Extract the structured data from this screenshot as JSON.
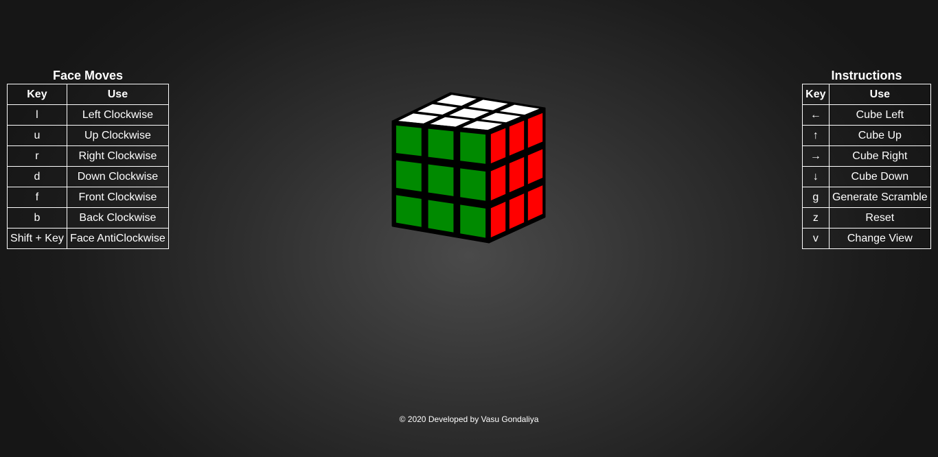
{
  "face_moves": {
    "title": "Face Moves",
    "header_key": "Key",
    "header_use": "Use",
    "rows": [
      {
        "key": "l",
        "use": "Left Clockwise"
      },
      {
        "key": "u",
        "use": "Up Clockwise"
      },
      {
        "key": "r",
        "use": "Right Clockwise"
      },
      {
        "key": "d",
        "use": "Down Clockwise"
      },
      {
        "key": "f",
        "use": "Front Clockwise"
      },
      {
        "key": "b",
        "use": "Back Clockwise"
      },
      {
        "key": "Shift + Key",
        "use": "Face AntiClockwise"
      }
    ]
  },
  "instructions": {
    "title": "Instructions",
    "header_key": "Key",
    "header_use": "Use",
    "rows": [
      {
        "key": "←",
        "use": "Cube Left"
      },
      {
        "key": "↑",
        "use": "Cube Up"
      },
      {
        "key": "→",
        "use": "Cube Right"
      },
      {
        "key": "↓",
        "use": "Cube Down"
      },
      {
        "key": "g",
        "use": "Generate Scramble"
      },
      {
        "key": "z",
        "use": "Reset"
      },
      {
        "key": "v",
        "use": "Change View"
      }
    ]
  },
  "cube": {
    "faces": {
      "top": [
        "white",
        "white",
        "white",
        "white",
        "white",
        "white",
        "white",
        "white",
        "white"
      ],
      "front": [
        "green",
        "green",
        "green",
        "green",
        "green",
        "green",
        "green",
        "green",
        "green"
      ],
      "right": [
        "red",
        "red",
        "red",
        "red",
        "red",
        "red",
        "red",
        "red",
        "red"
      ]
    },
    "colors": {
      "white": "#ffffff",
      "green": "#008a00",
      "red": "#ff0000",
      "frame": "#000000"
    }
  },
  "footer": {
    "text": "© 2020 Developed by Vasu Gondaliya"
  }
}
